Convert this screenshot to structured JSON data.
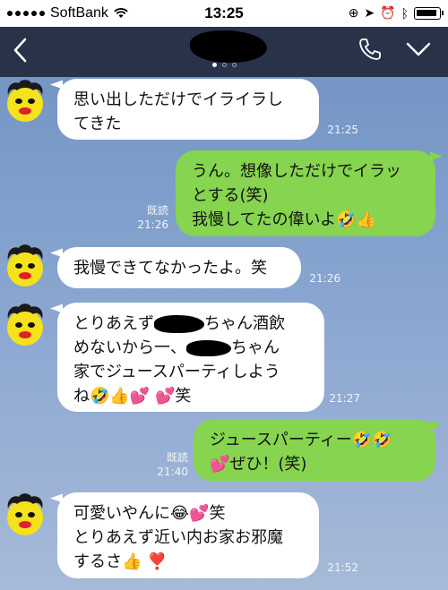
{
  "status_bar": {
    "carrier": "SoftBank",
    "time": "13:25"
  },
  "header": {
    "page_indicator": {
      "count": 3,
      "active": 1
    }
  },
  "messages": [
    {
      "side": "in",
      "lines": [
        "思い出しただけでイライラし",
        "てきた"
      ],
      "time": "21:25"
    },
    {
      "side": "out",
      "lines": [
        "うん。想像しただけでイラッ",
        "とする(笑)",
        "我慢してたの偉いよ🤣👍"
      ],
      "read": "既読",
      "time": "21:26"
    },
    {
      "side": "in",
      "lines": [
        "我慢できてなかったよ。笑"
      ],
      "time": "21:26"
    },
    {
      "side": "in",
      "line1_pre": "とりあえず",
      "line1_post": "ちゃん酒飲",
      "line2_pre": "めないから一、",
      "line2_post": "ちゃん",
      "line3": "家でジュースパーティしよう",
      "line4": "ね🤣👍💕 💕笑",
      "time": "21:27"
    },
    {
      "side": "out",
      "lines": [
        "ジュースパーティー🤣🤣",
        "💕ぜひ！(笑)"
      ],
      "read": "既読",
      "time": "21:40"
    },
    {
      "side": "in",
      "lines": [
        "可愛いやんに😂💕笑",
        "とりあえず近い内お家お邪魔",
        "するさ👍 ❣️"
      ],
      "time": "21:52"
    }
  ]
}
